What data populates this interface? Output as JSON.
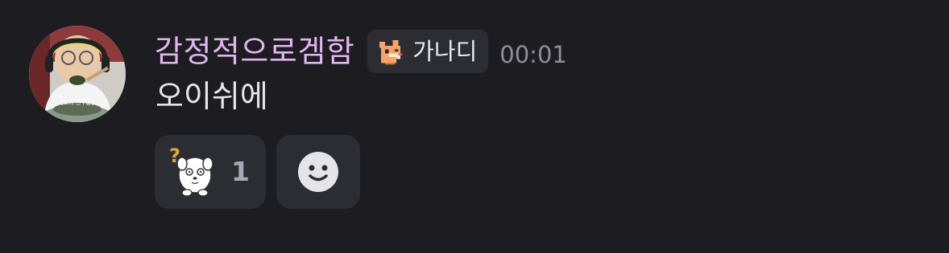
{
  "message": {
    "author": "감정적으로겜함",
    "badge": {
      "label": "가나디",
      "icon": "dog-icon"
    },
    "timestamp": "00:01",
    "text": "오이쉬에",
    "avatar_caption": "[쏘더 친구들]"
  },
  "reactions": [
    {
      "icon": "confused-dog-sticker-icon",
      "count": "1"
    }
  ],
  "add_reaction": {
    "icon": "smiley-icon"
  },
  "colors": {
    "background": "#1c1c21",
    "author": "#e3b6ef",
    "chip": "#2c2c33",
    "timestamp": "#8f8f99"
  }
}
